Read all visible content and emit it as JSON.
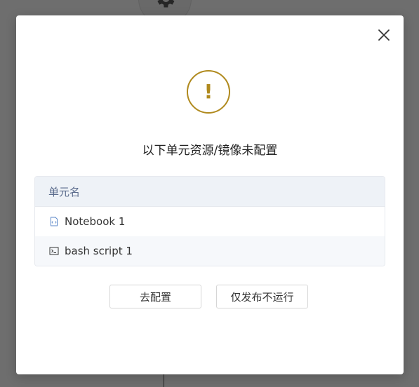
{
  "dialog": {
    "title": "以下单元资源/镜像未配置",
    "table": {
      "header": "单元名",
      "rows": [
        {
          "icon": "notebook-icon",
          "name": "Notebook 1"
        },
        {
          "icon": "terminal-icon",
          "name": "bash script 1"
        }
      ]
    },
    "buttons": {
      "configure": "去配置",
      "publish_only": "仅发布不运行"
    },
    "warning_symbol": "!"
  },
  "colors": {
    "warning": "#b08a1e",
    "table_header_bg": "#eef2f7",
    "table_header_text": "#5a6b8c",
    "overlay": "rgba(0,0,0,0.55)"
  }
}
